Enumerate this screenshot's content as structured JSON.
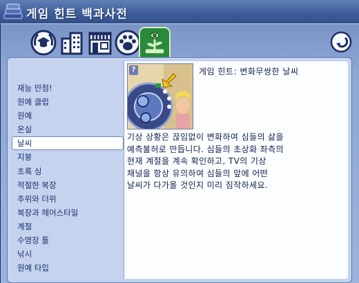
{
  "window": {
    "title": "게임 힌트 백과사전",
    "title_icon": "books-icon"
  },
  "tabs": [
    {
      "name": "tab-skills",
      "icon": "graduation-laurel-icon"
    },
    {
      "name": "tab-buildings",
      "icon": "buildings-icon"
    },
    {
      "name": "tab-shop",
      "icon": "shop-awning-icon"
    },
    {
      "name": "tab-pets",
      "icon": "paw-icon"
    },
    {
      "name": "tab-nature",
      "icon": "flower-icon",
      "active": true
    }
  ],
  "back_icon": "back-arrow-icon",
  "topics": [
    {
      "label": "재능 만점!"
    },
    {
      "label": "원예 클럽"
    },
    {
      "label": "원예"
    },
    {
      "label": "온실"
    },
    {
      "label": "날씨",
      "selected": true
    },
    {
      "label": "지붕"
    },
    {
      "label": "초록 싱"
    },
    {
      "label": "적절한 복장"
    },
    {
      "label": "추위와 더위"
    },
    {
      "label": "복장과 헤어스타일"
    },
    {
      "label": "계절"
    },
    {
      "label": "수영장 툴"
    },
    {
      "label": "낚시"
    },
    {
      "label": "원예 타입"
    }
  ],
  "detail": {
    "help_badge": "?",
    "title": "게임 힌트: 변화무쌍한 날씨",
    "body_lines": [
      "기상 상황은 끊임없이 변화하여 심들의 삶을",
      "예측불허로 만듭니다. 심들의 초상화 좌측의",
      "현재 계절을 계속 확인하고, TV의 기상",
      "채널을 항상 유의하여 심들의 앞에 어떤",
      "날씨가 다가올 것인지 미리 짐작하세요."
    ]
  },
  "colors": {
    "title_bar": "#4a6aa6",
    "panel": "#8ea7d4",
    "active_tab": "#2b8a3a",
    "text": "#0f2050"
  }
}
